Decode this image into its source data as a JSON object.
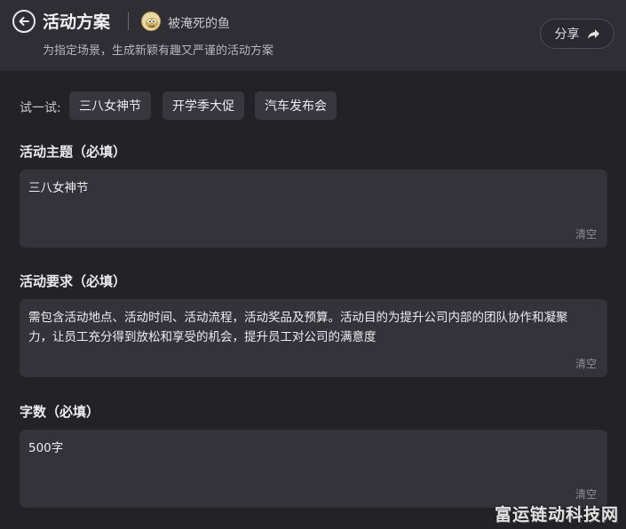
{
  "header": {
    "title": "活动方案",
    "author": "被淹死的鱼",
    "subtitle": "为指定场景，生成新颖有趣又严谨的活动方案",
    "share_label": "分享"
  },
  "suggestions": {
    "label": "试一试:",
    "chips": [
      "三八女神节",
      "开学季大促",
      "汽车发布会"
    ]
  },
  "form": {
    "theme": {
      "label": "活动主题（必填）",
      "value": "三八女神节",
      "clear_label": "清空"
    },
    "requirements": {
      "label": "活动要求（必填）",
      "value": "需包含活动地点、活动时间、活动流程，活动奖品及预算。活动目的为提升公司内部的团队协作和凝聚力，让员工充分得到放松和享受的机会，提升员工对公司的满意度",
      "clear_label": "清空"
    },
    "word_count": {
      "label": "字数（必填）",
      "value": "500字",
      "clear_label": "清空"
    }
  },
  "watermark": "富运链动科技网",
  "icons": {
    "back": "back-arrow-icon",
    "share": "share-arrow-icon"
  }
}
